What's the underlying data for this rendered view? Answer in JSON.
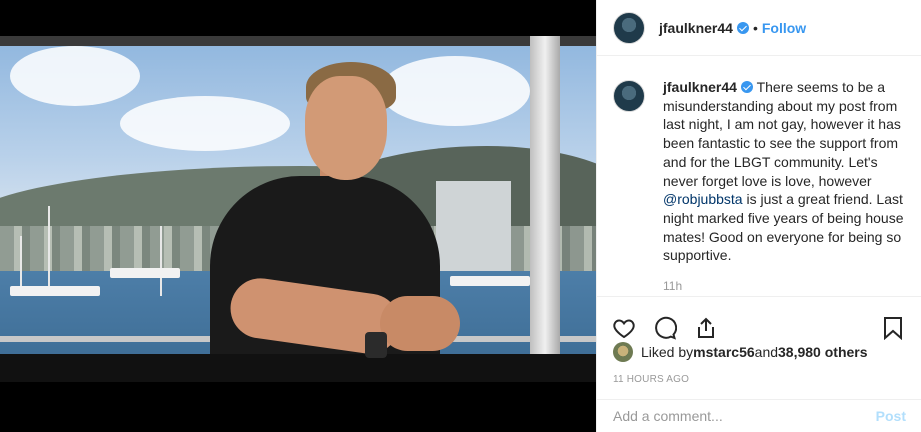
{
  "post": {
    "username": "jfaulkner44",
    "dot": "•",
    "follow_label": "Follow",
    "caption_part1": " There seems to be a misunderstanding about my post from last night, I am not gay, however it has been fantastic to see the support from and for the LBGT community. Let's never forget love is love, however ",
    "mention": "@robjubbsta",
    "caption_part2": " is just a great friend. Last night marked five years of being house mates! Good on everyone for being so supportive.",
    "comment_time": "11h",
    "likes_prefix": "Liked by ",
    "likes_user": "mstarc56",
    "likes_and": " and ",
    "likes_count": "38,980 others",
    "timestamp": "11 HOURS AGO"
  },
  "add_comment": {
    "placeholder": "Add a comment...",
    "post_label": "Post"
  },
  "icons": {
    "like": "heart-icon",
    "comment": "comment-icon",
    "share": "share-icon",
    "save": "bookmark-icon",
    "verified": "verified-badge-icon"
  },
  "colors": {
    "link_blue": "#3897f0",
    "post_disabled": "#b2dffc",
    "muted": "#999999",
    "mention": "#003569"
  }
}
